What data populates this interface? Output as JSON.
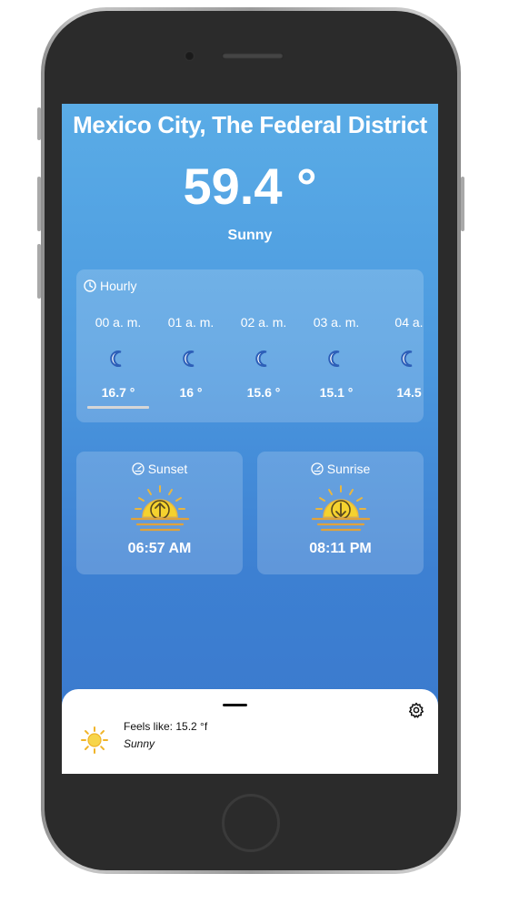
{
  "location": {
    "city": "Mexico City, The Federal District"
  },
  "current": {
    "temperature": "59.4 °",
    "condition": "Sunny"
  },
  "hourly": {
    "label": "Hourly",
    "items": [
      {
        "time": "00 a. m.",
        "temp": "16.7 °",
        "icon": "moon-icon"
      },
      {
        "time": "01 a. m.",
        "temp": "16 °",
        "icon": "moon-icon"
      },
      {
        "time": "02 a. m.",
        "temp": "15.6 °",
        "icon": "moon-icon"
      },
      {
        "time": "03 a. m.",
        "temp": "15.1 °",
        "icon": "moon-icon"
      },
      {
        "time": "04 a.",
        "temp": "14.5",
        "icon": "moon-icon"
      }
    ]
  },
  "sunset": {
    "label": "Sunset",
    "time": "06:57 AM",
    "icon": "sun-arrow-up-icon"
  },
  "sunrise": {
    "label": "Sunrise",
    "time": "08:11 PM",
    "icon": "sun-arrow-down-icon"
  },
  "sheet": {
    "feels_like": "Feels like: 15.2 °f",
    "condition": "Sunny",
    "icon": "sun-icon",
    "settings_icon": "gear-icon"
  },
  "colors": {
    "sky_top": "#5aace6",
    "sky_bottom": "#3a78cc",
    "sun_yellow": "#f5d22e",
    "sun_stroke": "#e0a23b"
  }
}
